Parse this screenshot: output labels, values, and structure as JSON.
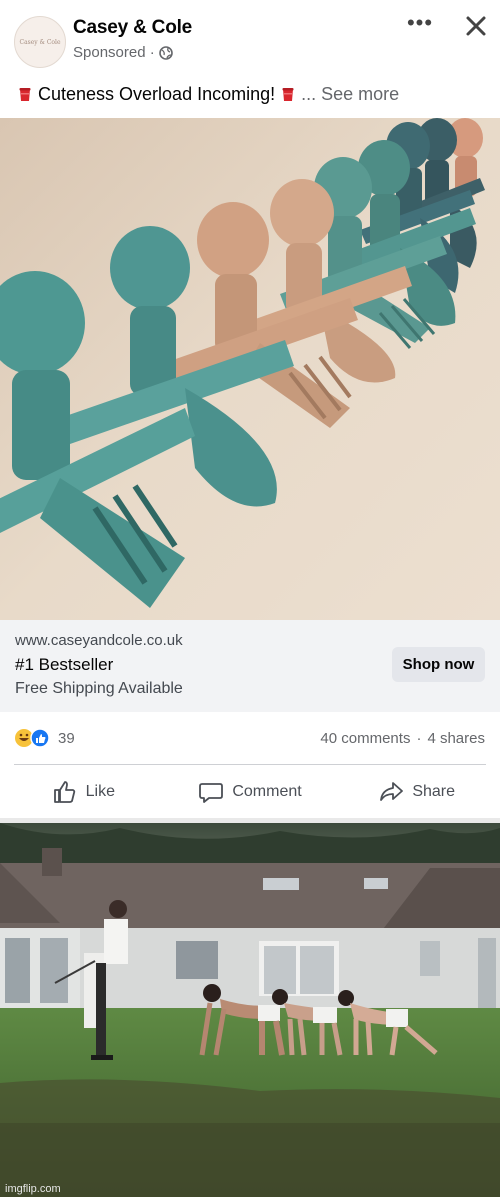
{
  "post": {
    "page_name": "Casey & Cole",
    "avatar_text": "Casey & Cole",
    "sponsored": "Sponsored ·",
    "more": "•••",
    "caption": "Cuteness Overload Incoming!",
    "see_more": "... See more"
  },
  "link": {
    "url": "www.caseyandcole.co.uk",
    "title": "#1 Bestseller",
    "description": "Free Shipping Available",
    "cta": "Shop now"
  },
  "stats": {
    "reactions": "39",
    "comments": "40 comments",
    "dot": "·",
    "shares": "4 shares"
  },
  "actions": {
    "like": "Like",
    "comment": "Comment",
    "share": "Share"
  },
  "watermark": "imgflip.com",
  "colors": {
    "teal": "#4e9590",
    "peach": "#c79a7c",
    "link_bar": "#f2f3f5",
    "grass": "#4f7a3a"
  }
}
